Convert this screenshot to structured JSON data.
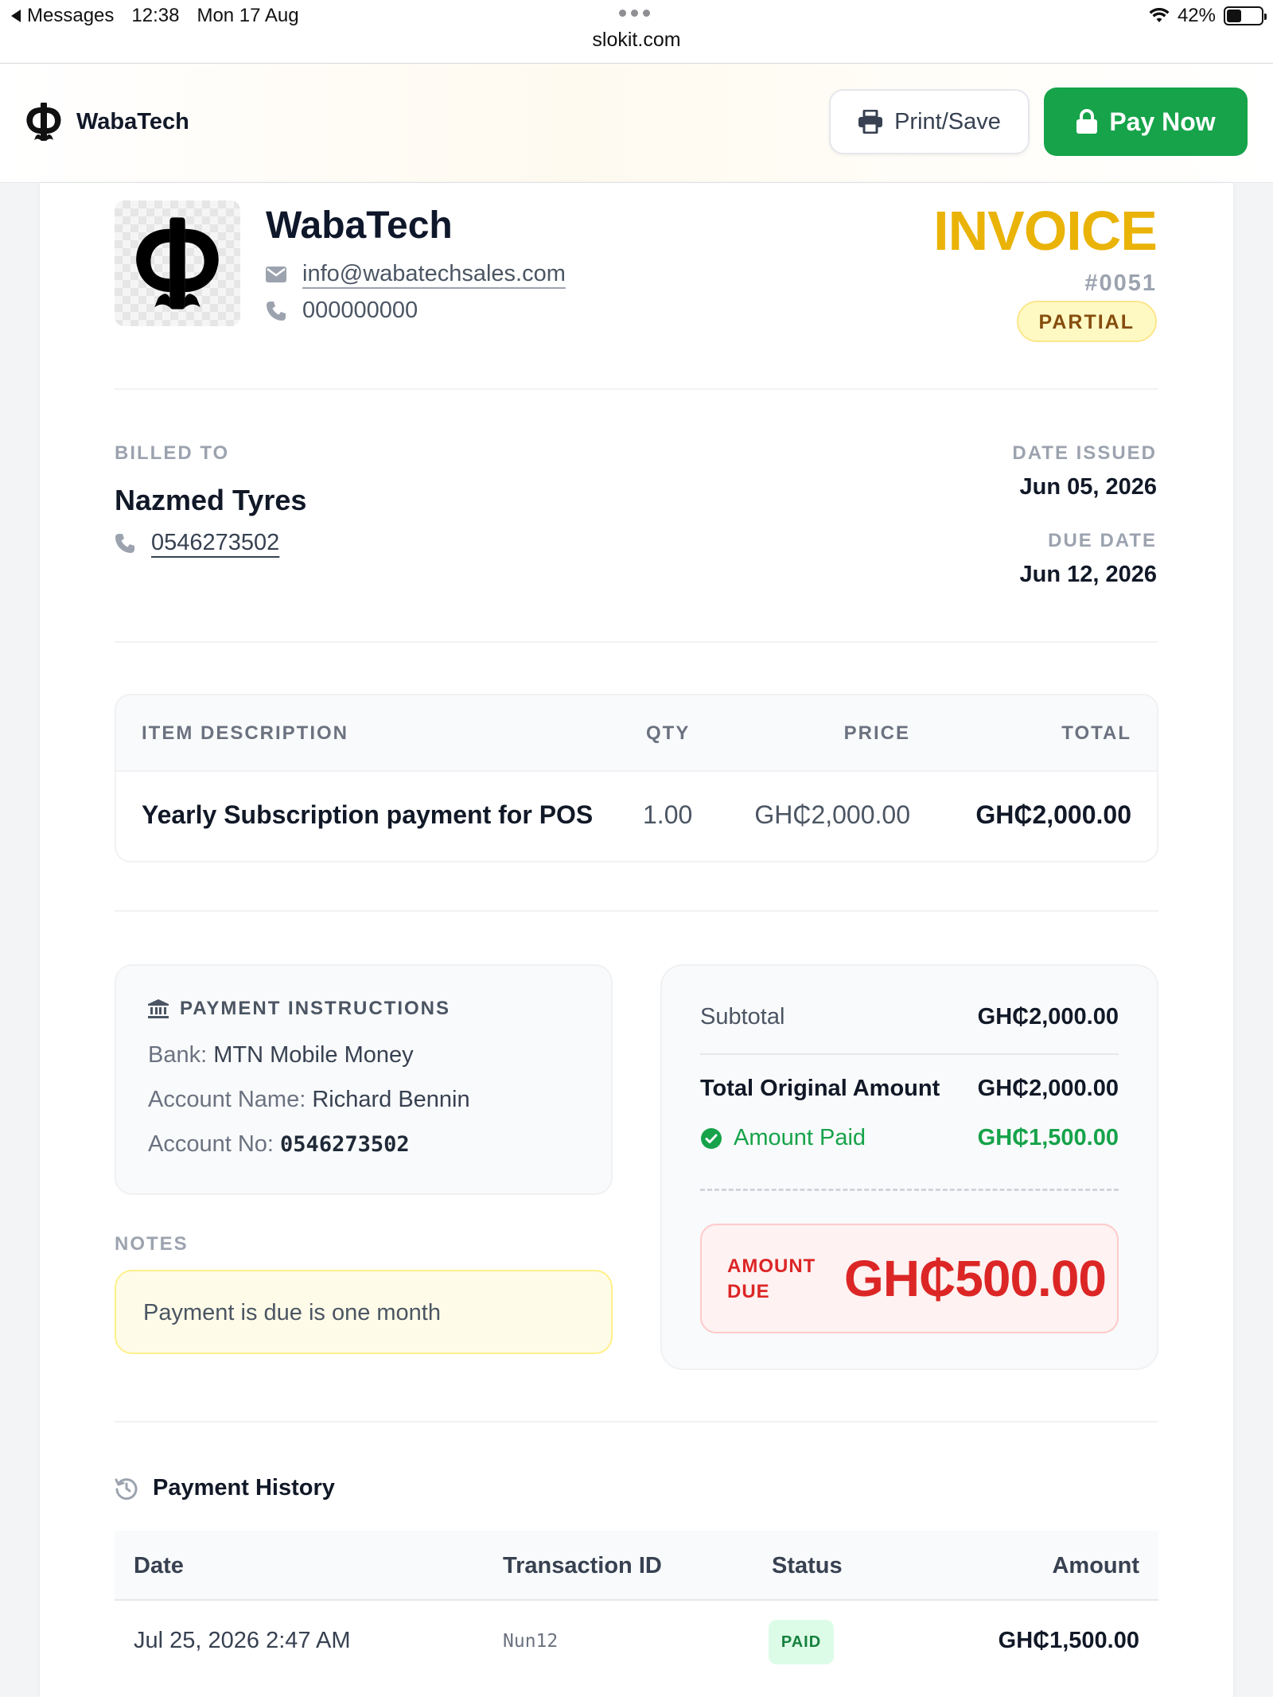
{
  "status_bar": {
    "back_app": "Messages",
    "time": "12:38",
    "date": "Mon 17 Aug",
    "url": "slokit.com",
    "battery": "42%",
    "battery_level": 0.42
  },
  "header": {
    "brand": "WabaTech",
    "print_label": "Print/Save",
    "pay_label": "Pay Now",
    "pay_color": "#16a34a"
  },
  "company": {
    "name": "WabaTech",
    "email": "info@wabatechsales.com",
    "phone": "000000000"
  },
  "invoice": {
    "title": "INVOICE",
    "number": "#0051",
    "status": "PARTIAL",
    "title_color": "#eab308"
  },
  "billing": {
    "billed_to_label": "BILLED TO",
    "client_name": "Nazmed Tyres",
    "client_phone": "0546273502",
    "date_issued_label": "DATE ISSUED",
    "date_issued": "Jun 05, 2026",
    "due_date_label": "DUE DATE",
    "due_date": "Jun 12, 2026"
  },
  "items_table": {
    "headers": {
      "description": "ITEM DESCRIPTION",
      "qty": "QTY",
      "price": "PRICE",
      "total": "TOTAL"
    },
    "rows": [
      {
        "description": "Yearly Subscription payment for POS",
        "qty": "1.00",
        "price": "GH₵2,000.00",
        "total": "GH₵2,000.00"
      }
    ]
  },
  "payment_instructions": {
    "title": "PAYMENT INSTRUCTIONS",
    "bank_label": "Bank:",
    "bank": "MTN Mobile Money",
    "account_name_label": "Account Name:",
    "account_name": "Richard Bennin",
    "account_no_label": "Account No:",
    "account_no": "0546273502"
  },
  "notes": {
    "label": "NOTES",
    "text": "Payment is due is one month"
  },
  "totals": {
    "subtotal_label": "Subtotal",
    "subtotal": "GH₵2,000.00",
    "original_label": "Total Original Amount",
    "original": "GH₵2,000.00",
    "paid_label": "Amount Paid",
    "paid": "GH₵1,500.00",
    "due_label": "AMOUNT DUE",
    "due": "GH₵500.00",
    "paid_color": "#16a34a",
    "due_color": "#dc2626"
  },
  "payment_history": {
    "title": "Payment History",
    "headers": {
      "date": "Date",
      "transaction_id": "Transaction ID",
      "status": "Status",
      "amount": "Amount"
    },
    "rows": [
      {
        "date": "Jul 25, 2026 2:47 AM",
        "transaction_id": "Nun12",
        "status": "PAID",
        "amount": "GH₵1,500.00"
      }
    ]
  }
}
